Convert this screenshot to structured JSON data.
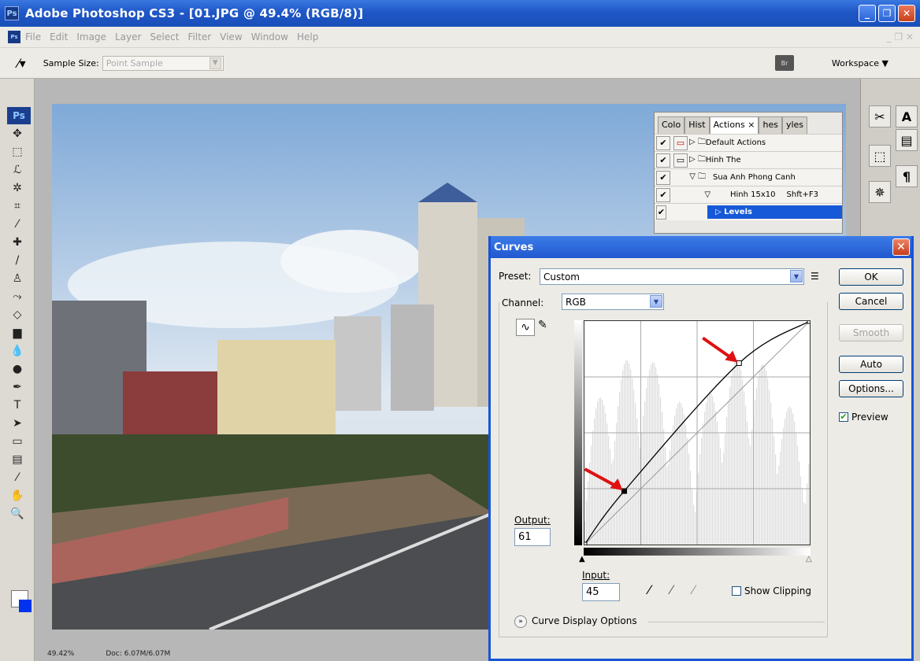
{
  "window": {
    "title": "Adobe Photoshop CS3 - [01.JPG @ 49.4% (RGB/8)]",
    "icon": "photoshop-icon"
  },
  "menu": [
    "File",
    "Edit",
    "Image",
    "Layer",
    "Select",
    "Filter",
    "View",
    "Window",
    "Help"
  ],
  "options": {
    "sample_size_label": "Sample Size:",
    "sample_size_value": "Point Sample",
    "workspace_label": "Workspace ▼"
  },
  "status": {
    "zoom": "49.42%",
    "doc": "Doc: 6.07M/6.07M"
  },
  "actions_panel": {
    "tabs": [
      "Colo",
      "Hist",
      "Actions ×",
      "hes",
      "yles"
    ],
    "rows": [
      {
        "label": "Default Actions",
        "shortcut": ""
      },
      {
        "label": "Hinh The",
        "shortcut": ""
      },
      {
        "label": "Sua Anh Phong Canh",
        "shortcut": ""
      },
      {
        "label": "Hinh 15x10",
        "shortcut": "Shft+F3"
      },
      {
        "label": "Levels",
        "shortcut": ""
      }
    ]
  },
  "curves": {
    "title": "Curves",
    "preset_label": "Preset:",
    "preset_value": "Custom",
    "channel_label": "Channel:",
    "channel_value": "RGB",
    "buttons": {
      "ok": "OK",
      "cancel": "Cancel",
      "smooth": "Smooth",
      "auto": "Auto",
      "options": "Options..."
    },
    "preview_label": "Preview",
    "preview_checked": true,
    "output_label": "Output:",
    "output_value": "61",
    "input_label": "Input:",
    "input_value": "45",
    "show_clipping_label": "Show Clipping",
    "display_options_label": "Curve Display Options",
    "points": [
      [
        0,
        0
      ],
      [
        45,
        61
      ],
      [
        175,
        207
      ],
      [
        255,
        255
      ]
    ]
  }
}
